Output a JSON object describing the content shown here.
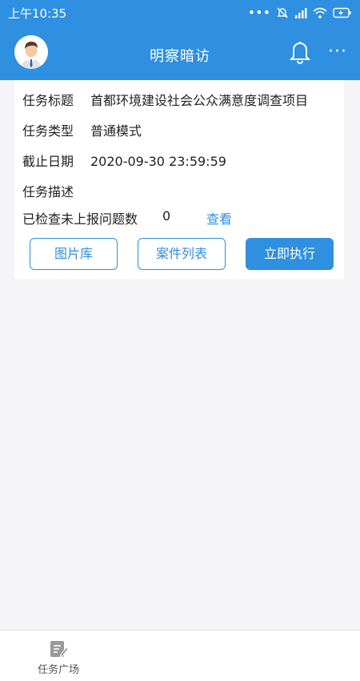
{
  "status_bar": {
    "time": "上午10:35",
    "battery_icon": "battery-charging-icon",
    "signal_icon": "signal-icon",
    "wifi_icon": "wifi-icon",
    "mute_icon": "mute-bell-icon"
  },
  "app_bar": {
    "title": "明察暗访",
    "avatar_icon": "user-avatar-icon",
    "bell_icon": "bell-icon",
    "more_icon": "more-icon",
    "more_label": "···"
  },
  "task": {
    "title_label": "任务标题",
    "title_value": "首都环境建设社会公众满意度调查项目",
    "type_label": "任务类型",
    "type_value": "普通模式",
    "deadline_label": "截止日期",
    "deadline_value": "2020-09-30 23:59:59",
    "desc_label": "任务描述",
    "desc_value": "",
    "unreported_label": "已检查未上报问题数",
    "unreported_count": "0",
    "view_link": "查看"
  },
  "actions": {
    "gallery": "图片库",
    "cases": "案件列表",
    "execute": "立即执行"
  },
  "bottom_nav": {
    "tab_label": "任务广场",
    "tab_icon": "task-square-icon"
  },
  "colors": {
    "primary": "#2f8fe0",
    "background": "#f5f5f7",
    "card": "#ffffff"
  }
}
